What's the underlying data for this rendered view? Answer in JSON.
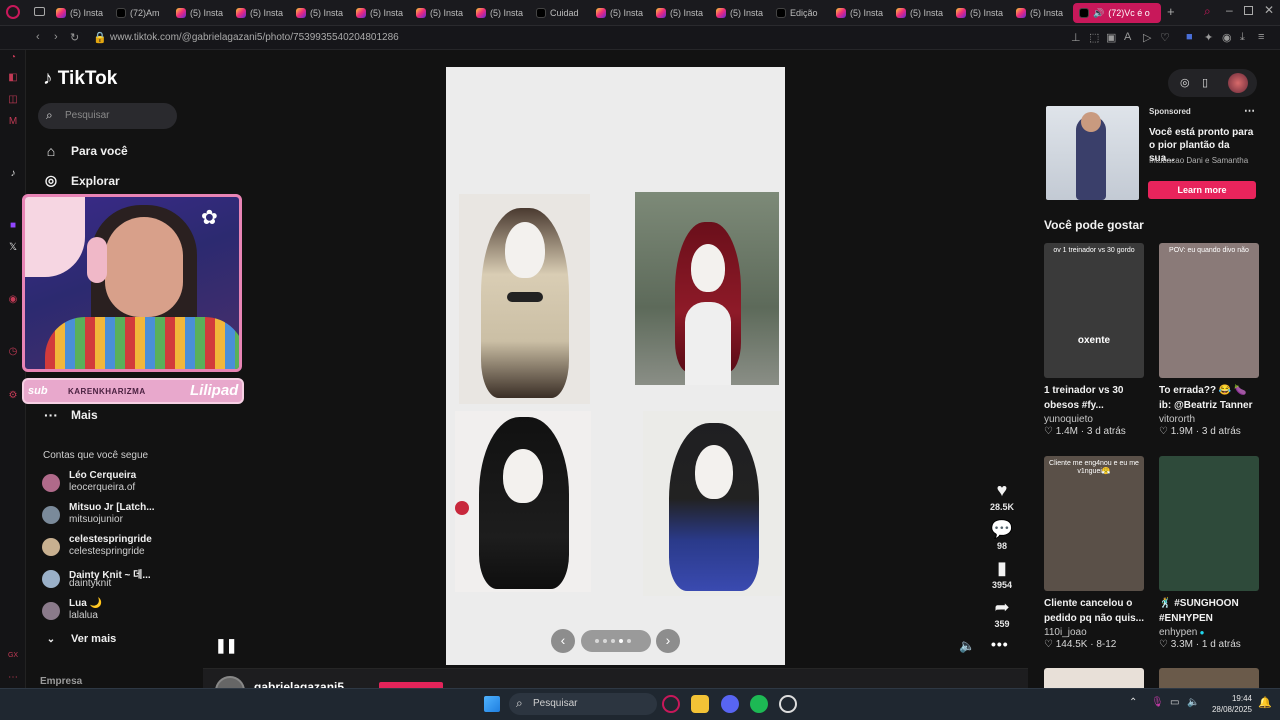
{
  "browser": {
    "url": "www.tiktok.com/@gabrielagazani5/photo/7539935540204801286",
    "tabs": [
      {
        "label": "(5) Insta",
        "kind": "ig"
      },
      {
        "label": "(72)Am",
        "kind": "tt"
      },
      {
        "label": "(5) Insta",
        "kind": "ig"
      },
      {
        "label": "(5) Insta",
        "kind": "ig"
      },
      {
        "label": "(5) Insta",
        "kind": "ig"
      },
      {
        "label": "(5) Insta",
        "kind": "ig"
      },
      {
        "label": "(5) Insta",
        "kind": "ig"
      },
      {
        "label": "(5) Insta",
        "kind": "ig"
      },
      {
        "label": "Cuidad",
        "kind": "tt"
      },
      {
        "label": "(5) Insta",
        "kind": "ig"
      },
      {
        "label": "(5) Insta",
        "kind": "ig"
      },
      {
        "label": "(5) Insta",
        "kind": "ig"
      },
      {
        "label": "Edição",
        "kind": "tt"
      },
      {
        "label": "(5) Insta",
        "kind": "ig"
      },
      {
        "label": "(5) Insta",
        "kind": "ig"
      },
      {
        "label": "(5) Insta",
        "kind": "ig"
      },
      {
        "label": "(5) Insta",
        "kind": "ig"
      }
    ],
    "active_tab": "(72)Vc é o"
  },
  "sidebar": {
    "logo": "TikTok",
    "search_placeholder": "Pesquisar",
    "nav": [
      {
        "label": "Para você",
        "icon": "home-icon"
      },
      {
        "label": "Explorar",
        "icon": "compass-icon"
      }
    ],
    "more_label": "Mais",
    "following_heading": "Contas que você segue",
    "accounts": [
      {
        "name": "Léo Cerqueira",
        "handle": "leocerqueira.of",
        "color": "#b06a8a"
      },
      {
        "name": "Mitsuo Jr [Latch...",
        "handle": "mitsuojunior",
        "color": "#7a8a9a"
      },
      {
        "name": "celestespringride",
        "handle": "celestespringride",
        "color": "#c8b090"
      },
      {
        "name": "Dainty Knit ~ 데...",
        "handle": "daintyknit",
        "color": "#9ab0c8"
      },
      {
        "name": "Lua 🌙",
        "handle": "lalalua",
        "color": "#8a7a8a"
      }
    ],
    "see_more": "Ver mais",
    "footer": "Empresa"
  },
  "stream_overlay": {
    "banner_left": "sub",
    "banner_name": "KARENKHARIZMA",
    "banner_right": "Lilipad"
  },
  "post": {
    "author": "gabrielagazani5",
    "slides_total": 5,
    "slide_current": 4
  },
  "actions": {
    "likes": "28.5K",
    "comments": "98",
    "saves": "3954",
    "shares": "359"
  },
  "sponsored": {
    "label": "Sponsored",
    "title": "Você está pronto para o pior plantão da sua...",
    "subtitle": "Intubacao Dani e Samantha",
    "cta": "Learn more"
  },
  "recommendations": {
    "heading": "Você pode gostar",
    "items": [
      {
        "title": "1 treinador vs 30 obesos #fy...",
        "author": "yunoquieto",
        "likes": "1.4M",
        "age": "3 d atrás",
        "verified": false,
        "caption_top": "ov 1 treinador vs 30 gordo",
        "caption_mid": "oxente",
        "bg": "#3a3a3a"
      },
      {
        "title": "To errada?? 😂 🍆 ib: @Beatriz Tanner",
        "author": "vitororth",
        "likes": "1.9M",
        "age": "3 d atrás",
        "verified": false,
        "caption_top": "POV: eu quando divo não",
        "caption_mid": "",
        "bg": "#8a7a78"
      },
      {
        "title": "Cliente cancelou o pedido pq não quis...",
        "author": "110i_joao",
        "likes": "144.5K",
        "age": "8-12",
        "verified": false,
        "caption_top": "Cliente me eng4nou e eu me v1nguei😤",
        "caption_mid": "",
        "bg": "#5a5048"
      },
      {
        "title": "🕺 #SUNGHOON #ENHYPEN",
        "author": "enhypen",
        "likes": "3.3M",
        "age": "1 d atrás",
        "verified": true,
        "caption_top": "",
        "caption_mid": "",
        "bg": "#2e4a3a"
      }
    ]
  },
  "taskbar": {
    "search": "Pesquisar",
    "time": "19:44",
    "date": "28/08/2025"
  }
}
